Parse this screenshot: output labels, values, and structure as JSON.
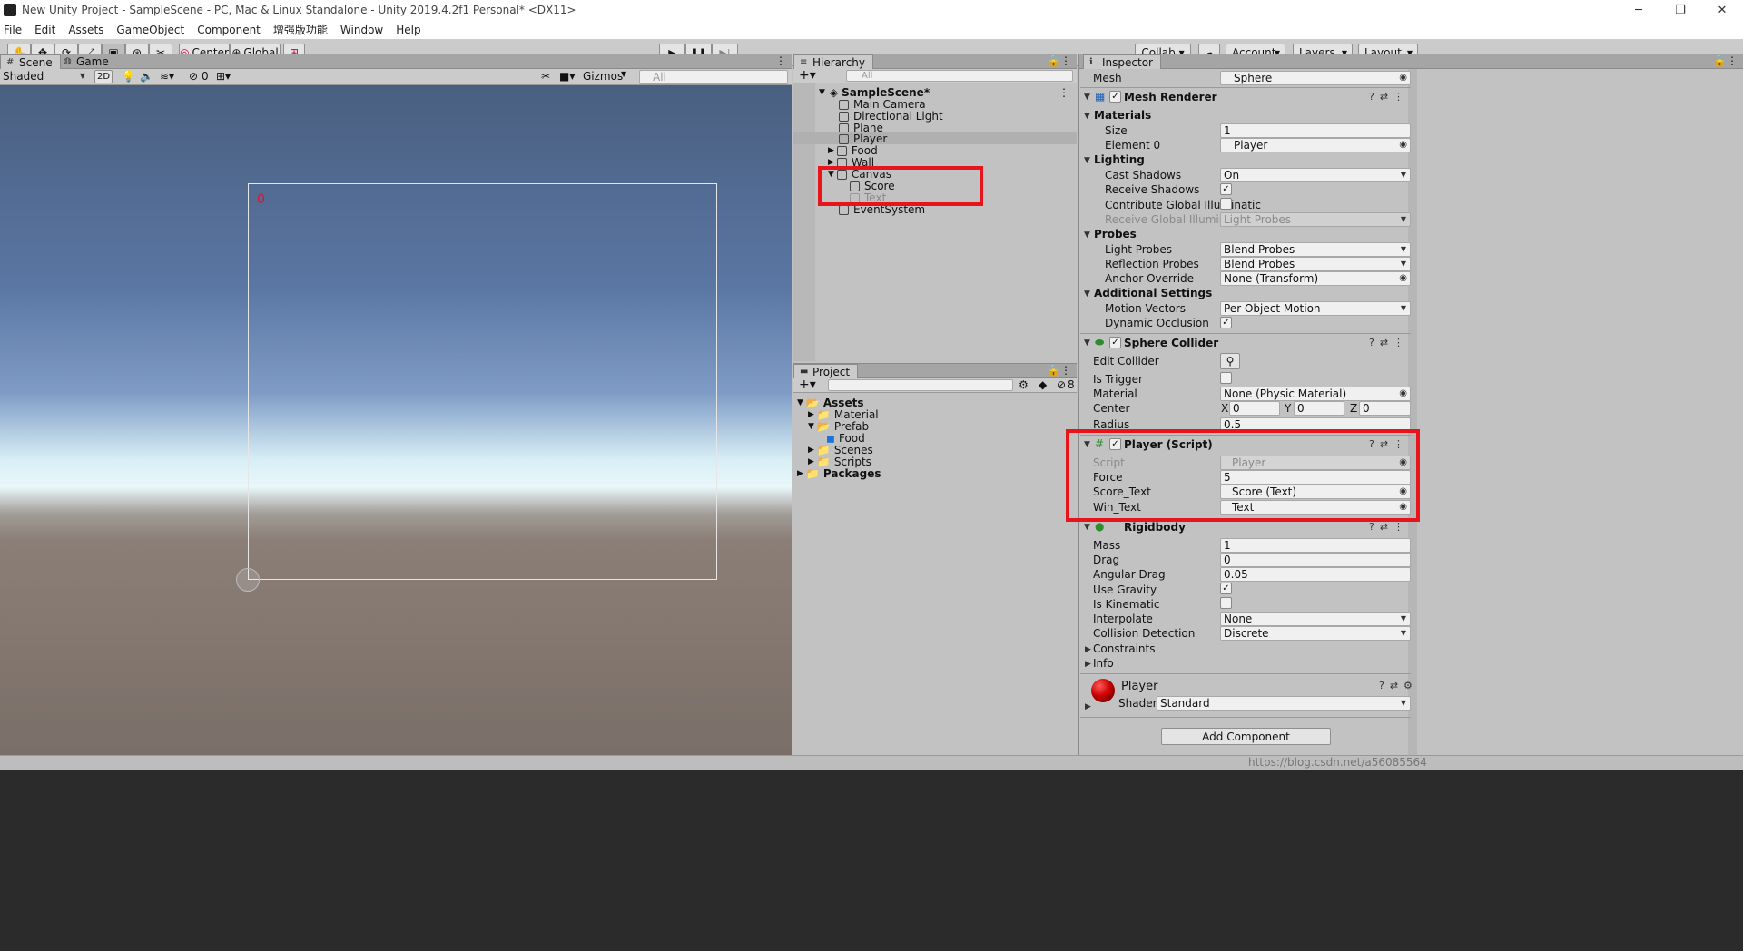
{
  "window": {
    "title": "New Unity Project - SampleScene - PC, Mac & Linux Standalone - Unity 2019.4.2f1 Personal* <DX11>"
  },
  "menu": [
    "File",
    "Edit",
    "Assets",
    "GameObject",
    "Component",
    "增强版功能",
    "Window",
    "Help"
  ],
  "toolbar": {
    "center": "Center",
    "global": "Global",
    "collab": "Collab",
    "account": "Account",
    "layers": "Layers",
    "layout": "Layout"
  },
  "scene": {
    "tab_scene": "Scene",
    "tab_game": "Game",
    "shading": "Shaded",
    "mode_2d": "2D",
    "hidden_count": "0",
    "gizmos": "Gizmos",
    "search_placeholder": "All",
    "score_text": "0"
  },
  "hierarchy": {
    "tab": "Hierarchy",
    "search_placeholder": "All",
    "scene_name": "SampleScene*",
    "items": [
      "Main Camera",
      "Directional Light",
      "Plane",
      "Player",
      "Food",
      "Wall",
      "Canvas",
      "Score",
      "Text",
      "EventSystem"
    ]
  },
  "project": {
    "tab": "Project",
    "hidden_count": "8",
    "tree": [
      "Assets",
      "Material",
      "Prefab",
      "Food",
      "Scenes",
      "Scripts",
      "Packages"
    ]
  },
  "inspector": {
    "tab": "Inspector",
    "mesh_label": "Mesh",
    "mesh_value": "Sphere",
    "mesh_renderer": {
      "title": "Mesh Renderer",
      "materials": "Materials",
      "size_label": "Size",
      "size_value": "1",
      "element0_label": "Element 0",
      "element0_value": "Player",
      "lighting": "Lighting",
      "cast_shadows_label": "Cast Shadows",
      "cast_shadows_value": "On",
      "receive_shadows_label": "Receive Shadows",
      "contribute_gi_label": "Contribute Global Illuminatic",
      "receive_gi_label": "Receive Global Illumination",
      "receive_gi_value": "Light Probes",
      "probes": "Probes",
      "light_probes_label": "Light Probes",
      "light_probes_value": "Blend Probes",
      "reflection_probes_label": "Reflection Probes",
      "reflection_probes_value": "Blend Probes",
      "anchor_override_label": "Anchor Override",
      "anchor_override_value": "None (Transform)",
      "additional": "Additional Settings",
      "motion_vectors_label": "Motion Vectors",
      "motion_vectors_value": "Per Object Motion",
      "dynamic_occlusion_label": "Dynamic Occlusion"
    },
    "sphere_collider": {
      "title": "Sphere Collider",
      "edit_collider": "Edit Collider",
      "is_trigger": "Is Trigger",
      "material_label": "Material",
      "material_value": "None (Physic Material)",
      "center_label": "Center",
      "x_label": "X",
      "x": "0",
      "y_label": "Y",
      "y": "0",
      "z_label": "Z",
      "z": "0",
      "radius_label": "Radius",
      "radius": "0.5"
    },
    "player_script": {
      "title": "Player (Script)",
      "script_label": "Script",
      "script_value": "Player",
      "force_label": "Force",
      "force_value": "5",
      "score_text_label": "Score_Text",
      "score_text_value": "Score (Text)",
      "win_text_label": "Win_Text",
      "win_text_value": "Text"
    },
    "rigidbody": {
      "title": "Rigidbody",
      "mass_label": "Mass",
      "mass": "1",
      "drag_label": "Drag",
      "drag": "0",
      "angular_drag_label": "Angular Drag",
      "angular_drag": "0.05",
      "use_gravity_label": "Use Gravity",
      "is_kinematic_label": "Is Kinematic",
      "interpolate_label": "Interpolate",
      "interpolate": "None",
      "collision_label": "Collision Detection",
      "collision": "Discrete",
      "constraints": "Constraints",
      "info": "Info"
    },
    "material": {
      "name": "Player",
      "shader_label": "Shader",
      "shader": "Standard"
    },
    "add_component": "Add Component"
  },
  "watermark": "https://blog.csdn.net/a56085564"
}
